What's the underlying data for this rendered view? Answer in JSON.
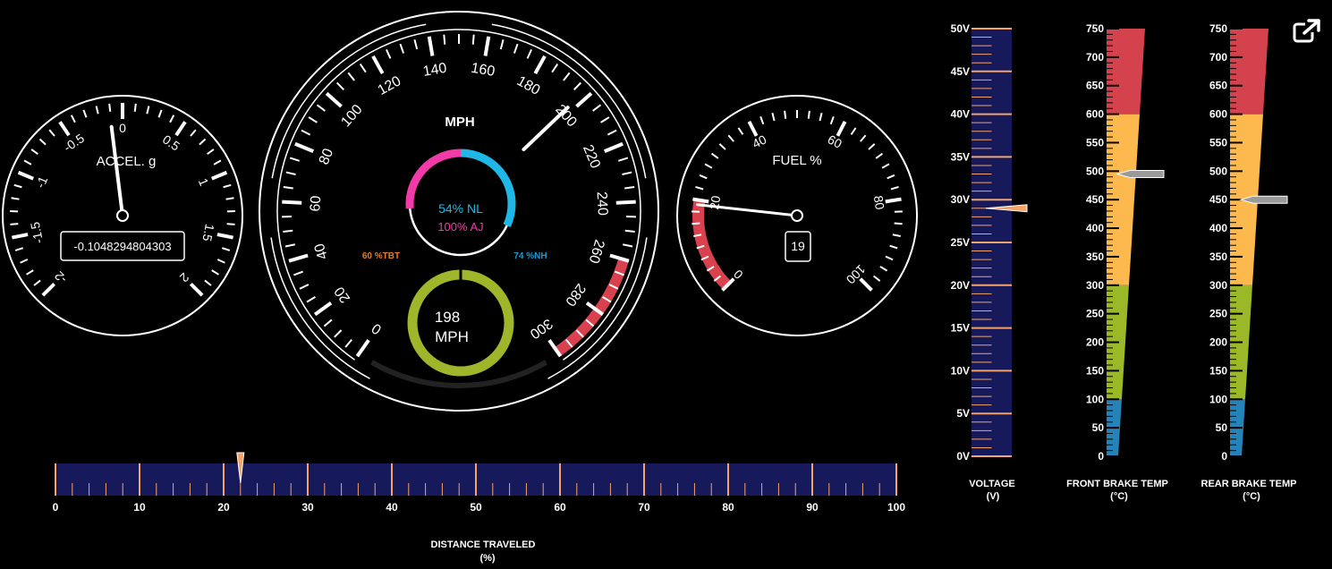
{
  "colors": {
    "background": "#000000",
    "ink": "#ffffff",
    "redline": "#d9414e",
    "navy": "#16195a",
    "orange": "#f4a36b",
    "nl_cyan": "#1fb8e6",
    "aj_magenta": "#f23aa8",
    "ring_green": "#9fb52a",
    "tbt_orange": "#e67c22",
    "nh_blue": "#1a9cd8",
    "temp_red": "#d4424d",
    "temp_yellow": "#fdb94e",
    "temp_green": "#9ab827",
    "temp_blue": "#2683b8"
  },
  "popout_icon": "external-link-icon",
  "accel": {
    "title": "ACCEL. g",
    "readout": "-0.1048294804303",
    "ticks": [
      "-2",
      "-1.5",
      "-1",
      "-0.5",
      "0",
      "0.5",
      "1",
      "1.5",
      "2"
    ],
    "value": -0.1048294804303
  },
  "speed": {
    "title": "MPH",
    "ticks": [
      "0",
      "20",
      "40",
      "60",
      "80",
      "100",
      "120",
      "140",
      "160",
      "180",
      "200",
      "220",
      "240",
      "260",
      "280",
      "300"
    ],
    "value": 198,
    "redline_from": 260,
    "nl_text": "54% NL",
    "aj_text": "100% AJ",
    "nl": 0.54,
    "aj": 1.0,
    "tbt_text": "60 %TBT",
    "nh_text": "74 %NH",
    "center_value": "198",
    "center_unit": "MPH"
  },
  "fuel": {
    "title": "FUEL %",
    "ticks": [
      "0",
      "20",
      "40",
      "60",
      "80",
      "100"
    ],
    "value": 19,
    "readout": "19",
    "red_to": 20
  },
  "distance": {
    "title": "DISTANCE TRAVELED",
    "unit": "(%)",
    "ticks": [
      "0",
      "10",
      "20",
      "30",
      "40",
      "50",
      "60",
      "70",
      "80",
      "90",
      "100"
    ],
    "value": 22
  },
  "voltage": {
    "title": "VOLTAGE",
    "unit": "(V)",
    "ticks": [
      "0V",
      "5V",
      "10V",
      "15V",
      "20V",
      "25V",
      "30V",
      "35V",
      "40V",
      "45V",
      "50V"
    ],
    "value": 29
  },
  "front_brake": {
    "title": "FRONT BRAKE TEMP",
    "unit": "(°C)",
    "ticks": [
      "0",
      "50",
      "100",
      "150",
      "200",
      "250",
      "300",
      "350",
      "400",
      "450",
      "500",
      "550",
      "600",
      "650",
      "700",
      "750"
    ],
    "value": 495,
    "bands": [
      {
        "to": 100,
        "color": "#2683b8"
      },
      {
        "to": 300,
        "color": "#9ab827"
      },
      {
        "to": 600,
        "color": "#fdb94e"
      },
      {
        "to": 750,
        "color": "#d4424d"
      }
    ]
  },
  "rear_brake": {
    "title": "REAR BRAKE TEMP",
    "unit": "(°C)",
    "ticks": [
      "0",
      "50",
      "100",
      "150",
      "200",
      "250",
      "300",
      "350",
      "400",
      "450",
      "500",
      "550",
      "600",
      "650",
      "700",
      "750"
    ],
    "value": 450,
    "bands": [
      {
        "to": 100,
        "color": "#2683b8"
      },
      {
        "to": 300,
        "color": "#9ab827"
      },
      {
        "to": 600,
        "color": "#fdb94e"
      },
      {
        "to": 750,
        "color": "#d4424d"
      }
    ]
  }
}
